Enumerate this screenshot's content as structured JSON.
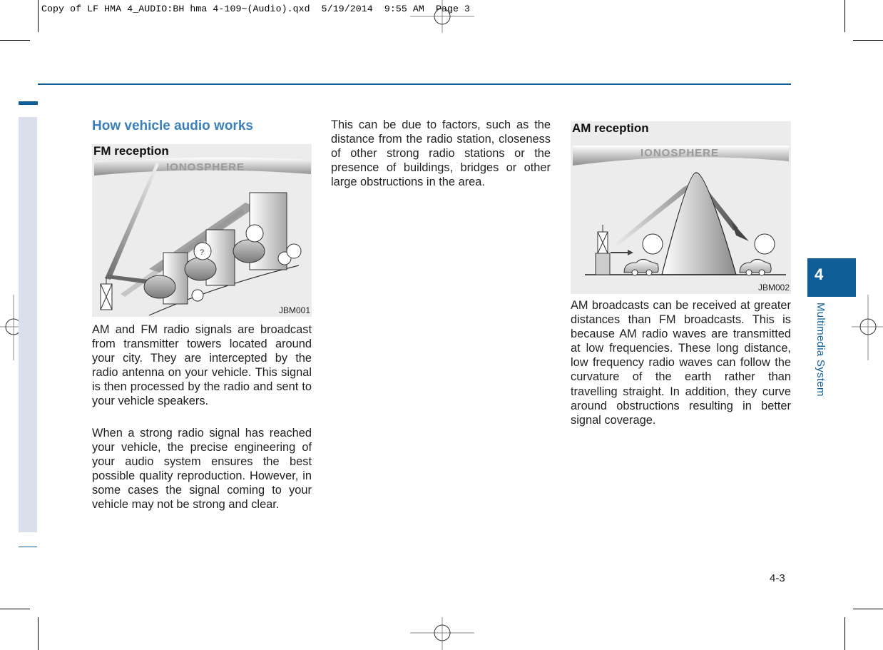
{
  "print_slug": "Copy of LF HMA 4_AUDIO:BH hma 4-109~(Audio).qxd  5/19/2014  9:55 AM  Page 3",
  "section": {
    "title": "How vehicle audio works"
  },
  "figures": {
    "fm": {
      "title": "FM reception",
      "ionosphere_label": "IONOSPHERE",
      "code": "JBM001"
    },
    "am": {
      "title": "AM reception",
      "ionosphere_label": "IONOSPHERE",
      "code": "JBM002"
    }
  },
  "column1": {
    "paragraphs": [
      "AM and FM radio signals are broadcast from transmitter towers located around your city. They are intercepted by the radio antenna on your vehicle. This signal is then processed by the radio and sent to your vehicle speakers.",
      "When a strong radio signal has reached your vehicle, the precise engineering of your audio system ensures the best possible quality reproduction. However, in some cases the signal coming to your vehicle may not be strong and clear."
    ]
  },
  "column2": {
    "paragraphs": [
      "This can be due to factors, such as the distance from the radio station, closeness of other strong radio stations or the presence of buildings, bridges or other large obstructions in the area."
    ]
  },
  "column3": {
    "paragraphs": [
      "AM broadcasts can be received at greater distances than FM broadcasts. This is because AM radio waves are transmitted at low frequencies. These long distance, low frequency radio waves can follow the curvature of the earth rather than travelling straight. In addition, they curve around obstructions resulting in better signal coverage."
    ]
  },
  "chapter": {
    "number": "4",
    "label": "Multimedia System"
  },
  "page_number": "4-3",
  "colors": {
    "brand_blue": "#0f5e97",
    "heading_blue": "#3a80bd",
    "side_band": "#d9e0ec"
  }
}
